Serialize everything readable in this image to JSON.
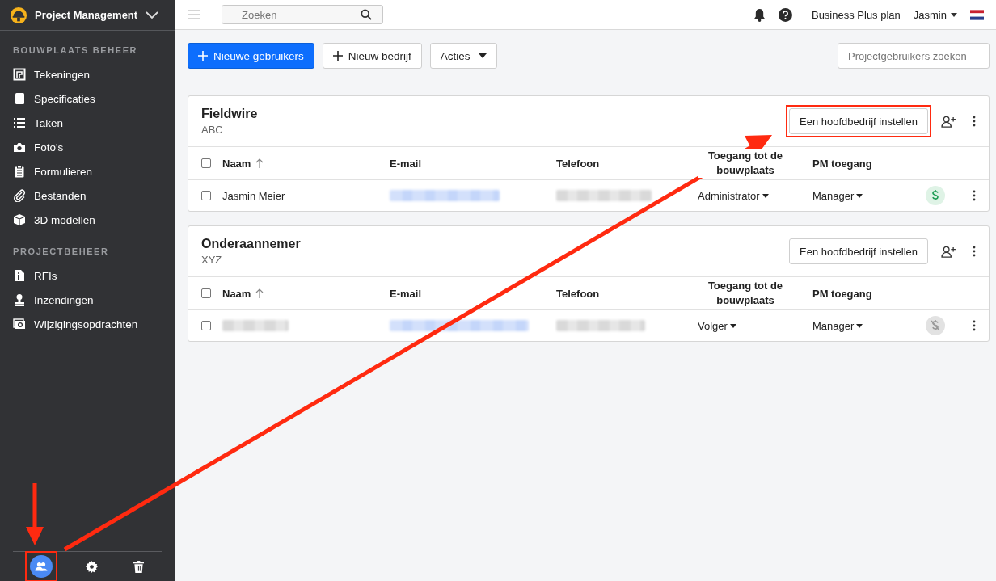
{
  "app": {
    "title": "Project Management"
  },
  "sidebar": {
    "sections": [
      {
        "label": "BOUWPLAATS BEHEER",
        "items": [
          {
            "label": "Tekeningen",
            "kind": "plan"
          },
          {
            "label": "Specificaties",
            "kind": "book"
          },
          {
            "label": "Taken",
            "kind": "list"
          },
          {
            "label": "Foto's",
            "kind": "camera"
          },
          {
            "label": "Formulieren",
            "kind": "clipboard"
          },
          {
            "label": "Bestanden",
            "kind": "clip"
          },
          {
            "label": "3D modellen",
            "kind": "cube"
          }
        ]
      },
      {
        "label": "PROJECTBEHEER",
        "items": [
          {
            "label": "RFIs",
            "kind": "info"
          },
          {
            "label": "Inzendingen",
            "kind": "stamp"
          },
          {
            "label": "Wijzigingsopdrachten",
            "kind": "change"
          }
        ]
      }
    ],
    "footer": [
      {
        "kind": "users",
        "selected": true,
        "highlighted": true
      },
      {
        "kind": "settings",
        "selected": false,
        "highlighted": false
      },
      {
        "kind": "trash",
        "selected": false,
        "highlighted": false
      }
    ]
  },
  "topbar": {
    "search": {
      "placeholder": "Zoeken"
    },
    "plan": "Business Plus plan",
    "user": "Jasmin"
  },
  "toolbar": {
    "buttons": [
      {
        "label": "Nieuwe gebruikers",
        "kind": "primary"
      },
      {
        "label": "Nieuw bedrijf",
        "kind": "add"
      },
      {
        "label": "Acties",
        "kind": "dropdown"
      }
    ],
    "search": {
      "placeholder": "Projectgebruikers zoeken"
    }
  },
  "companies": [
    {
      "name": "Fieldwire",
      "code": "ABC",
      "all_selected": false,
      "action": {
        "label": "Een hoofdbedrijf instellen",
        "highlighted": true
      },
      "columns": [
        "Naam",
        "E-mail",
        "Telefoon",
        "Toegang tot de bouwplaats",
        "PM toegang"
      ],
      "rows": [
        {
          "name": "Jasmin Meier",
          "checked": false,
          "site_access": "Administrator",
          "pm_access": "Manager",
          "billable": true
        }
      ]
    },
    {
      "name": "Onderaannemer",
      "code": "XYZ",
      "all_selected": false,
      "action": {
        "label": "Een hoofdbedrijf instellen",
        "highlighted": false
      },
      "columns": [
        "Naam",
        "E-mail",
        "Telefoon",
        "Toegang tot de bouwplaats",
        "PM toegang"
      ],
      "rows": [
        {
          "checked": false,
          "site_access": "Volger",
          "pm_access": "Manager",
          "billable": false
        }
      ]
    }
  ]
}
